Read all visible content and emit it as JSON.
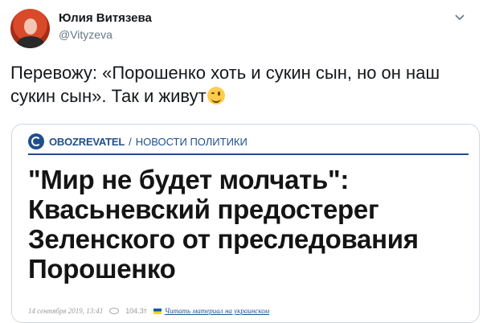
{
  "tweet": {
    "author_name": "Юлия Витязева",
    "author_handle": "@Vityzeva",
    "text": "Перевожу: «Порошенко хоть и сукин сын, но он наш сукин сын». Так и живут",
    "emoji": "winking-face"
  },
  "card": {
    "brand_name": "OBOZREVATEL",
    "brand_separator": "/",
    "brand_section": "НОВОСТИ ПОЛИТИКИ",
    "headline": "\"Мир не будет молчать\": Квасьневский предостерег Зеленского от преследования Порошенко",
    "date": "14 сентября 2019, 13:41",
    "views": "104.3т",
    "read_link": "Читать материал на украинском"
  },
  "colors": {
    "brand": "#1f4f8c",
    "text": "#14171a",
    "muted": "#657786",
    "card_border": "#ccd6dd"
  }
}
